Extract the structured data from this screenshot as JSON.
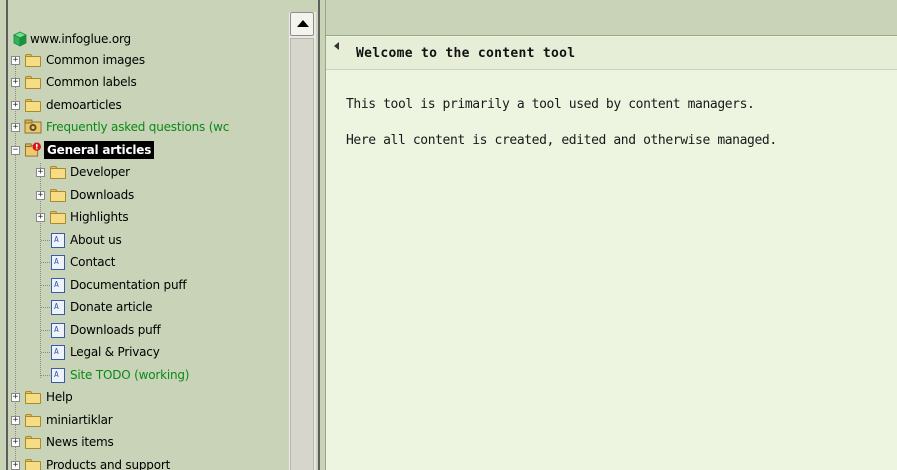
{
  "tree": {
    "root": {
      "label": "www.infoglue.org",
      "icon": "cube-icon"
    },
    "items": [
      {
        "label": "Common images",
        "type": "folder"
      },
      {
        "label": "Common labels",
        "type": "folder"
      },
      {
        "label": "demoarticles",
        "type": "folder"
      },
      {
        "label": "Frequently asked questions (wc",
        "type": "special-folder"
      },
      {
        "label": "General articles",
        "type": "special-folder",
        "selected": true
      },
      {
        "label": "Developer",
        "type": "folder"
      },
      {
        "label": "Downloads",
        "type": "folder"
      },
      {
        "label": "Highlights",
        "type": "folder"
      },
      {
        "label": "About us",
        "type": "article"
      },
      {
        "label": "Contact",
        "type": "article"
      },
      {
        "label": "Documentation puff",
        "type": "article"
      },
      {
        "label": "Donate article",
        "type": "article"
      },
      {
        "label": "Downloads puff",
        "type": "article"
      },
      {
        "label": "Legal & Privacy",
        "type": "article"
      },
      {
        "label": "Site TODO (working)",
        "type": "article"
      },
      {
        "label": "Help",
        "type": "folder"
      },
      {
        "label": "miniartiklar",
        "type": "folder"
      },
      {
        "label": "News items",
        "type": "folder"
      },
      {
        "label": "Products and support",
        "type": "folder"
      }
    ],
    "expander_collapsed": "+",
    "expander_expanded": "−"
  },
  "main": {
    "title": "Welcome to the content tool",
    "lines": [
      "This tool is primarily a tool used by content managers.",
      "Here all content is created, edited and otherwise managed."
    ]
  },
  "colors": {
    "tree_bg": "#c8d3b7",
    "content_bg": "#edf4e0",
    "header_bg": "#e6eed8",
    "working_text": "#0a8a18"
  }
}
